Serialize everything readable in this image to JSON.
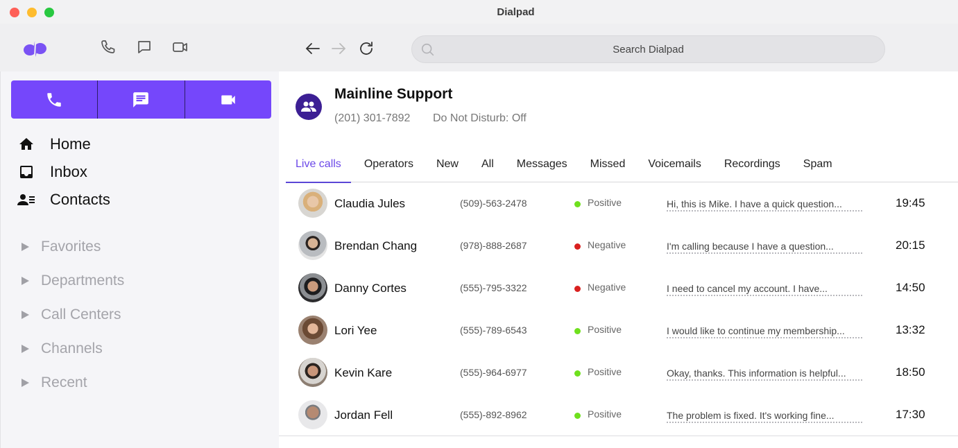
{
  "window": {
    "title": "Dialpad"
  },
  "toolbar": {
    "icons": [
      "phone-icon",
      "message-icon",
      "video-icon"
    ],
    "nav": [
      "back-arrow-icon",
      "forward-arrow-icon",
      "refresh-icon"
    ],
    "search_placeholder": "Search Dialpad",
    "search_value": ""
  },
  "sidebar": {
    "actions": [
      {
        "name": "call",
        "icon": "phone-icon"
      },
      {
        "name": "message",
        "icon": "message-icon"
      },
      {
        "name": "video",
        "icon": "video-icon"
      }
    ],
    "nav_items": [
      {
        "label": "Home",
        "icon": "home-icon"
      },
      {
        "label": "Inbox",
        "icon": "inbox-icon"
      },
      {
        "label": "Contacts",
        "icon": "contacts-icon"
      }
    ],
    "groups": [
      {
        "label": "Favorites"
      },
      {
        "label": "Departments"
      },
      {
        "label": "Call Centers"
      },
      {
        "label": "Channels"
      },
      {
        "label": "Recent"
      }
    ]
  },
  "header": {
    "title": "Mainline Support",
    "phone": "(201) 301-7892",
    "dnd": "Do Not Disturb: Off"
  },
  "tabs": [
    {
      "label": "Live calls",
      "active": true
    },
    {
      "label": "Operators"
    },
    {
      "label": "New"
    },
    {
      "label": "All"
    },
    {
      "label": "Messages"
    },
    {
      "label": "Missed"
    },
    {
      "label": "Voicemails"
    },
    {
      "label": "Recordings"
    },
    {
      "label": "Spam"
    }
  ],
  "colors": {
    "accent": "#7547fb",
    "positive": "#6fe01d",
    "negative": "#d9201f",
    "group_avatar": "#3c1f94"
  },
  "calls": [
    {
      "name": "Claudia Jules",
      "phone": "(509)-563-2478",
      "sentiment": "Positive",
      "snippet": "Hi, this is Mike. I have a quick question...",
      "time": "19:45"
    },
    {
      "name": "Brendan Chang",
      "phone": "(978)-888-2687",
      "sentiment": "Negative",
      "snippet": "I'm calling because I have a question...",
      "time": "20:15"
    },
    {
      "name": "Danny Cortes",
      "phone": "(555)-795-3322",
      "sentiment": "Negative",
      "snippet": "I need to cancel my account. I have...",
      "time": "14:50"
    },
    {
      "name": "Lori Yee",
      "phone": "(555)-789-6543",
      "sentiment": "Positive",
      "snippet": "I would like to continue my membership...",
      "time": "13:32"
    },
    {
      "name": "Kevin Kare",
      "phone": "(555)-964-6977",
      "sentiment": "Positive",
      "snippet": "Okay, thanks. This information is helpful...",
      "time": "18:50"
    },
    {
      "name": "Jordan Fell",
      "phone": "(555)-892-8962",
      "sentiment": "Positive",
      "snippet": "The problem is fixed. It's working fine...",
      "time": "17:30"
    }
  ]
}
